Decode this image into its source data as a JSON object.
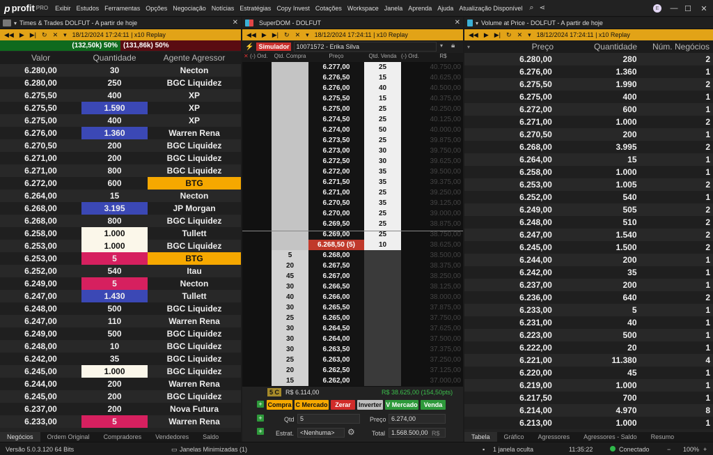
{
  "app": {
    "brand": "profit",
    "pro": "PRO",
    "menu": [
      "Exibir",
      "Estudos",
      "Ferramentas",
      "Opções",
      "Negociação",
      "Notícias",
      "Estratégias",
      "Copy Invest",
      "Cotações",
      "Workspace",
      "Janela",
      "Aprenda",
      "Ajuda",
      "Atualização Disponível"
    ],
    "avatar": "E"
  },
  "replay_time": "18/12/2024 17:24:11 | x10 Replay",
  "tt": {
    "title": "Times & Trades DOLFUT - A partir de hoje",
    "buy_pct": "(132,50k) 50%",
    "sell_pct": "(131,86k) 50%",
    "headers": [
      "Valor",
      "Quantidade",
      "Agente Agressor"
    ],
    "rows": [
      [
        "6.280,00",
        "30",
        "Necton",
        "",
        ""
      ],
      [
        "6.280,00",
        "250",
        "BGC Liquidez",
        "",
        ""
      ],
      [
        "6.275,50",
        "400",
        "XP",
        "",
        ""
      ],
      [
        "6.275,50",
        "1.590",
        "XP",
        "blue",
        ""
      ],
      [
        "6.275,00",
        "400",
        "XP",
        "",
        ""
      ],
      [
        "6.276,00",
        "1.360",
        "Warren Rena",
        "blue",
        ""
      ],
      [
        "6.270,50",
        "200",
        "BGC Liquidez",
        "",
        ""
      ],
      [
        "6.271,00",
        "200",
        "BGC Liquidez",
        "",
        ""
      ],
      [
        "6.271,00",
        "800",
        "BGC Liquidez",
        "",
        ""
      ],
      [
        "6.272,00",
        "600",
        "BTG",
        "",
        "orange"
      ],
      [
        "6.264,00",
        "15",
        "Necton",
        "",
        ""
      ],
      [
        "6.268,00",
        "3.195",
        "JP Morgan",
        "blue",
        ""
      ],
      [
        "6.268,00",
        "800",
        "BGC Liquidez",
        "",
        ""
      ],
      [
        "6.258,00",
        "1.000",
        "Tullett",
        "white",
        ""
      ],
      [
        "6.253,00",
        "1.000",
        "BGC Liquidez",
        "white",
        ""
      ],
      [
        "6.253,00",
        "5",
        "BTG",
        "pink",
        "orange"
      ],
      [
        "6.252,00",
        "540",
        "Itau",
        "",
        ""
      ],
      [
        "6.249,00",
        "5",
        "Necton",
        "pink",
        ""
      ],
      [
        "6.247,00",
        "1.430",
        "Tullett",
        "blue",
        ""
      ],
      [
        "6.248,00",
        "500",
        "BGC Liquidez",
        "",
        ""
      ],
      [
        "6.247,00",
        "110",
        "Warren Rena",
        "",
        ""
      ],
      [
        "6.249,00",
        "500",
        "BGC Liquidez",
        "",
        ""
      ],
      [
        "6.248,00",
        "10",
        "BGC Liquidez",
        "",
        ""
      ],
      [
        "6.242,00",
        "35",
        "BGC Liquidez",
        "",
        ""
      ],
      [
        "6.245,00",
        "1.000",
        "BGC Liquidez",
        "white",
        ""
      ],
      [
        "6.244,00",
        "200",
        "Warren Rena",
        "",
        ""
      ],
      [
        "6.245,00",
        "200",
        "BGC Liquidez",
        "",
        ""
      ],
      [
        "6.237,00",
        "200",
        "Nova Futura",
        "",
        ""
      ],
      [
        "6.233,00",
        "5",
        "Warren Rena",
        "pink",
        ""
      ]
    ],
    "tabs": [
      "Negócios",
      "Ordem Original",
      "Compradores",
      "Vendedores",
      "Saldo"
    ]
  },
  "dom": {
    "title": "SuperDOM - DOLFUT",
    "sim_label": "Simulador",
    "account": "10071572 - Erika Silva",
    "headers": [
      "(-) Ord.",
      "Qtd. Compra",
      "Preço",
      "Qtd. Venda",
      "(-) Ord.",
      "R$"
    ],
    "rows": [
      [
        "",
        "6.277,00",
        "25",
        "40.750,00"
      ],
      [
        "",
        "6.276,50",
        "15",
        "40.625,00"
      ],
      [
        "",
        "6.276,00",
        "40",
        "40.500,00"
      ],
      [
        "",
        "6.275,50",
        "15",
        "40.375,00"
      ],
      [
        "",
        "6.275,00",
        "25",
        "40.250,00"
      ],
      [
        "",
        "6.274,50",
        "25",
        "40.125,00"
      ],
      [
        "",
        "6.274,00",
        "50",
        "40.000,00"
      ],
      [
        "",
        "6.273,50",
        "25",
        "39.875,00"
      ],
      [
        "",
        "6.273,00",
        "30",
        "39.750,00"
      ],
      [
        "",
        "6.272,50",
        "30",
        "39.625,00"
      ],
      [
        "",
        "6.272,00",
        "35",
        "39.500,00"
      ],
      [
        "",
        "6.271,50",
        "35",
        "39.375,00"
      ],
      [
        "",
        "6.271,00",
        "25",
        "39.250,00"
      ],
      [
        "",
        "6.270,50",
        "35",
        "39.125,00"
      ],
      [
        "",
        "6.270,00",
        "25",
        "39.000,00"
      ],
      [
        "",
        "6.269,50",
        "25",
        "38.875,00"
      ],
      [
        "",
        "6.269,00",
        "25",
        "38.750,00"
      ],
      [
        "",
        "6.268,50 (5)",
        "10",
        "38.625,00"
      ],
      [
        "5",
        "6.268,00",
        "",
        "38.500,00"
      ],
      [
        "20",
        "6.267,50",
        "",
        "38.375,00"
      ],
      [
        "45",
        "6.267,00",
        "",
        "38.250,00"
      ],
      [
        "30",
        "6.266,50",
        "",
        "38.125,00"
      ],
      [
        "40",
        "6.266,00",
        "",
        "38.000,00"
      ],
      [
        "30",
        "6.265,50",
        "",
        "37.875,00"
      ],
      [
        "25",
        "6.265,00",
        "",
        "37.750,00"
      ],
      [
        "30",
        "6.264,50",
        "",
        "37.625,00"
      ],
      [
        "30",
        "6.264,00",
        "",
        "37.500,00"
      ],
      [
        "30",
        "6.263,50",
        "",
        "37.375,00"
      ],
      [
        "25",
        "6.263,00",
        "",
        "37.250,00"
      ],
      [
        "20",
        "6.262,50",
        "",
        "37.125,00"
      ],
      [
        "15",
        "6.262,00",
        "",
        "37.000,00"
      ]
    ],
    "pos_qty": "5 C",
    "pos_value": "R$ 6.114,00",
    "result": "R$ 38.625,00 (154,50pts)",
    "buttons": [
      "Compra",
      "C Mercado",
      "Zerar",
      "Inverter",
      "V Mercado",
      "Venda"
    ],
    "qtd_label": "Qtd",
    "qtd": "5",
    "preco_label": "Preço",
    "preco": "6.274,00",
    "estrat_label": "Estrat.",
    "estrat": "<Nenhuma>",
    "total_label": "Total",
    "total": "1.568.500,00",
    "total_unit": "R$"
  },
  "vap": {
    "title": "Volume at Price - DOLFUT - A partir de hoje",
    "headers": [
      "Preço",
      "Quantidade",
      "Núm. Negócios"
    ],
    "rows": [
      [
        "6.280,00",
        "280",
        "2"
      ],
      [
        "6.276,00",
        "1.360",
        "1"
      ],
      [
        "6.275,50",
        "1.990",
        "2"
      ],
      [
        "6.275,00",
        "400",
        "1"
      ],
      [
        "6.272,00",
        "600",
        "1"
      ],
      [
        "6.271,00",
        "1.000",
        "2"
      ],
      [
        "6.270,50",
        "200",
        "1"
      ],
      [
        "6.268,00",
        "3.995",
        "2"
      ],
      [
        "6.264,00",
        "15",
        "1"
      ],
      [
        "6.258,00",
        "1.000",
        "1"
      ],
      [
        "6.253,00",
        "1.005",
        "2"
      ],
      [
        "6.252,00",
        "540",
        "1"
      ],
      [
        "6.249,00",
        "505",
        "2"
      ],
      [
        "6.248,00",
        "510",
        "2"
      ],
      [
        "6.247,00",
        "1.540",
        "2"
      ],
      [
        "6.245,00",
        "1.500",
        "2"
      ],
      [
        "6.244,00",
        "200",
        "1"
      ],
      [
        "6.242,00",
        "35",
        "1"
      ],
      [
        "6.237,00",
        "200",
        "1"
      ],
      [
        "6.236,00",
        "640",
        "2"
      ],
      [
        "6.233,00",
        "5",
        "1"
      ],
      [
        "6.231,00",
        "40",
        "1"
      ],
      [
        "6.223,00",
        "500",
        "1"
      ],
      [
        "6.222,00",
        "20",
        "1"
      ],
      [
        "6.221,00",
        "11.380",
        "4"
      ],
      [
        "6.220,00",
        "45",
        "1"
      ],
      [
        "6.219,00",
        "1.000",
        "1"
      ],
      [
        "6.217,50",
        "700",
        "1"
      ],
      [
        "6.214,00",
        "4.970",
        "8"
      ],
      [
        "6.213,00",
        "1.000",
        "1"
      ]
    ],
    "tabs": [
      "Tabela",
      "Gráfico",
      "Agressores",
      "Agressores - Saldo",
      "Resumo"
    ]
  },
  "status": {
    "version": "Versão 5.0.3.120 64 Bits",
    "minimized": "Janelas Minimizadas (1)",
    "hidden": "1 janela oculta",
    "clock": "11:35:22",
    "connected": "Conectado",
    "zoom": "100%"
  },
  "colors": {
    "blue": "#3b48b5",
    "pink": "#d6205f",
    "white": "#fbf7ea",
    "orange": "#f6a800",
    "green": "#2e9a3b",
    "red": "#c8302d"
  }
}
